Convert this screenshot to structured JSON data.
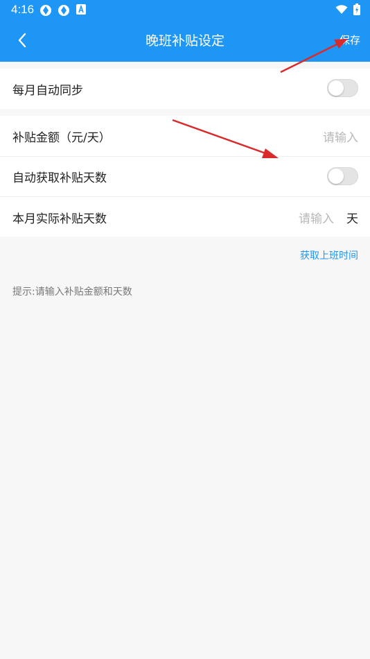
{
  "status_bar": {
    "time": "4:16",
    "icons": [
      "app-icon",
      "app-icon",
      "a-letter-icon"
    ],
    "right_icons": [
      "wifi-icon",
      "battery-icon"
    ]
  },
  "header": {
    "title": "晚班补贴设定",
    "save_label": "保存",
    "back_icon": "chevron-left-icon"
  },
  "rows": [
    {
      "label": "每月自动同步",
      "type": "toggle",
      "on": false
    },
    {
      "label": "补贴金额（元/天）",
      "type": "input",
      "placeholder": "请输入"
    },
    {
      "label": "自动获取补贴天数",
      "type": "toggle",
      "on": false
    },
    {
      "label": "本月实际补贴天数",
      "type": "input",
      "placeholder": "请输入",
      "unit": "天"
    }
  ],
  "link_label": "获取上班时间",
  "hint": "提示:请输入补贴金额和天数",
  "colors": {
    "accent": "#1e96f6",
    "annotation_arrow": "#d92b2b"
  }
}
